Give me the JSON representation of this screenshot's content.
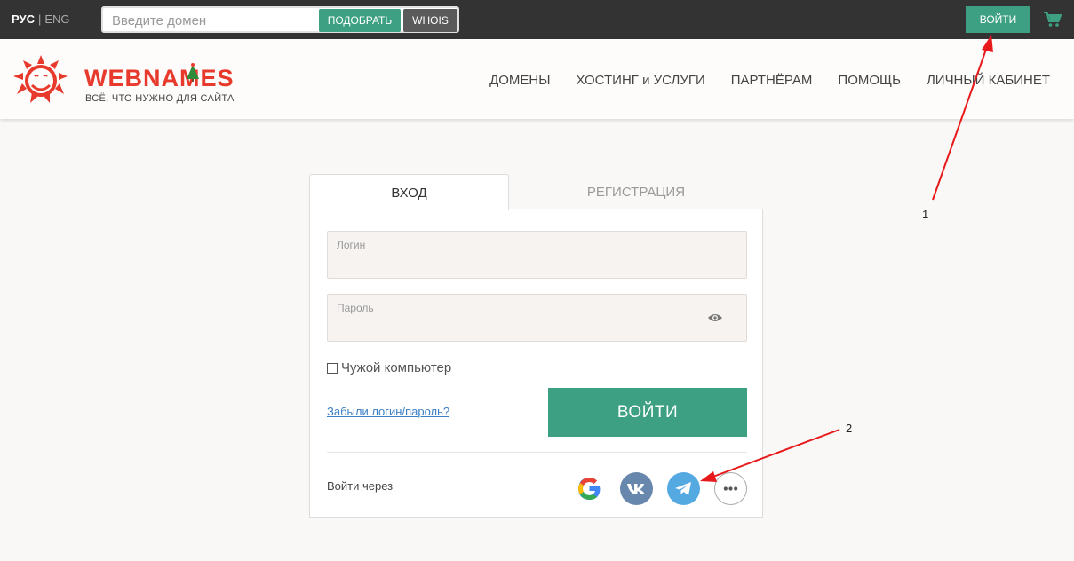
{
  "topbar": {
    "lang_active": "РУС",
    "lang_separator": "|",
    "lang_other": "ENG",
    "domain_placeholder": "Введите домен",
    "pick_label": "ПОДОБРАТЬ",
    "whois_label": "WHOIS",
    "login_label": "ВОЙТИ",
    "cart_icon": "cart-icon"
  },
  "header": {
    "logo_text": "WEBNAMES",
    "logo_tagline": "ВСЁ, ЧТО НУЖНО ДЛЯ САЙТА",
    "nav": [
      {
        "label": "ДОМЕНЫ"
      },
      {
        "label": "ХОСТИНГ и УСЛУГИ"
      },
      {
        "label": "ПАРТНЁРАМ"
      },
      {
        "label": "ПОМОЩЬ"
      },
      {
        "label": "ЛИЧНЫЙ КАБИНЕТ"
      }
    ]
  },
  "auth": {
    "tabs": [
      {
        "label": "ВХОД",
        "active": true
      },
      {
        "label": "РЕГИСТРАЦИЯ",
        "active": false
      }
    ],
    "login_label": "Логин",
    "password_label": "Пароль",
    "checkbox_label": "Чужой компьютер",
    "forgot_label": "Забыли логин/пароль?",
    "submit_label": "ВОЙТИ",
    "social_label": "Войти через",
    "social": [
      "google-icon",
      "vk-icon",
      "telegram-icon",
      "more-icon"
    ]
  },
  "annotations": {
    "label_1": "1",
    "label_2": "2",
    "arrow_color": "#e8191b"
  },
  "colors": {
    "accent": "#3da082",
    "topbar": "#333333",
    "brand": "#e83a2c"
  }
}
